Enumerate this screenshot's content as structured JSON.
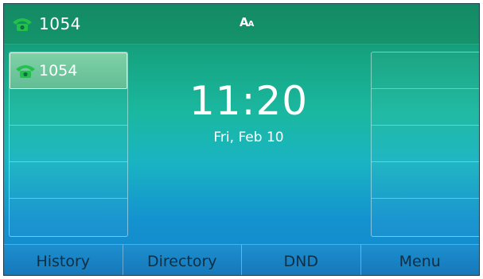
{
  "status_bar": {
    "account_label": "1054",
    "account_icon": "phone-handset-icon",
    "input_mode_big": "A",
    "input_mode_small": "A"
  },
  "line_keys": {
    "left": [
      {
        "label": "1054",
        "icon": "phone-handset-icon",
        "active": true
      },
      {
        "label": ""
      },
      {
        "label": ""
      },
      {
        "label": ""
      },
      {
        "label": ""
      }
    ],
    "right": [
      {
        "label": ""
      },
      {
        "label": ""
      },
      {
        "label": ""
      },
      {
        "label": ""
      },
      {
        "label": ""
      }
    ]
  },
  "idle": {
    "time": "11:20",
    "date": "Fri, Feb 10"
  },
  "softkeys": [
    {
      "label": "History"
    },
    {
      "label": "Directory"
    },
    {
      "label": "DND"
    },
    {
      "label": "Menu"
    }
  ],
  "colors": {
    "icon_green": "#22c24a",
    "softkey_text": "#0e2f44"
  }
}
